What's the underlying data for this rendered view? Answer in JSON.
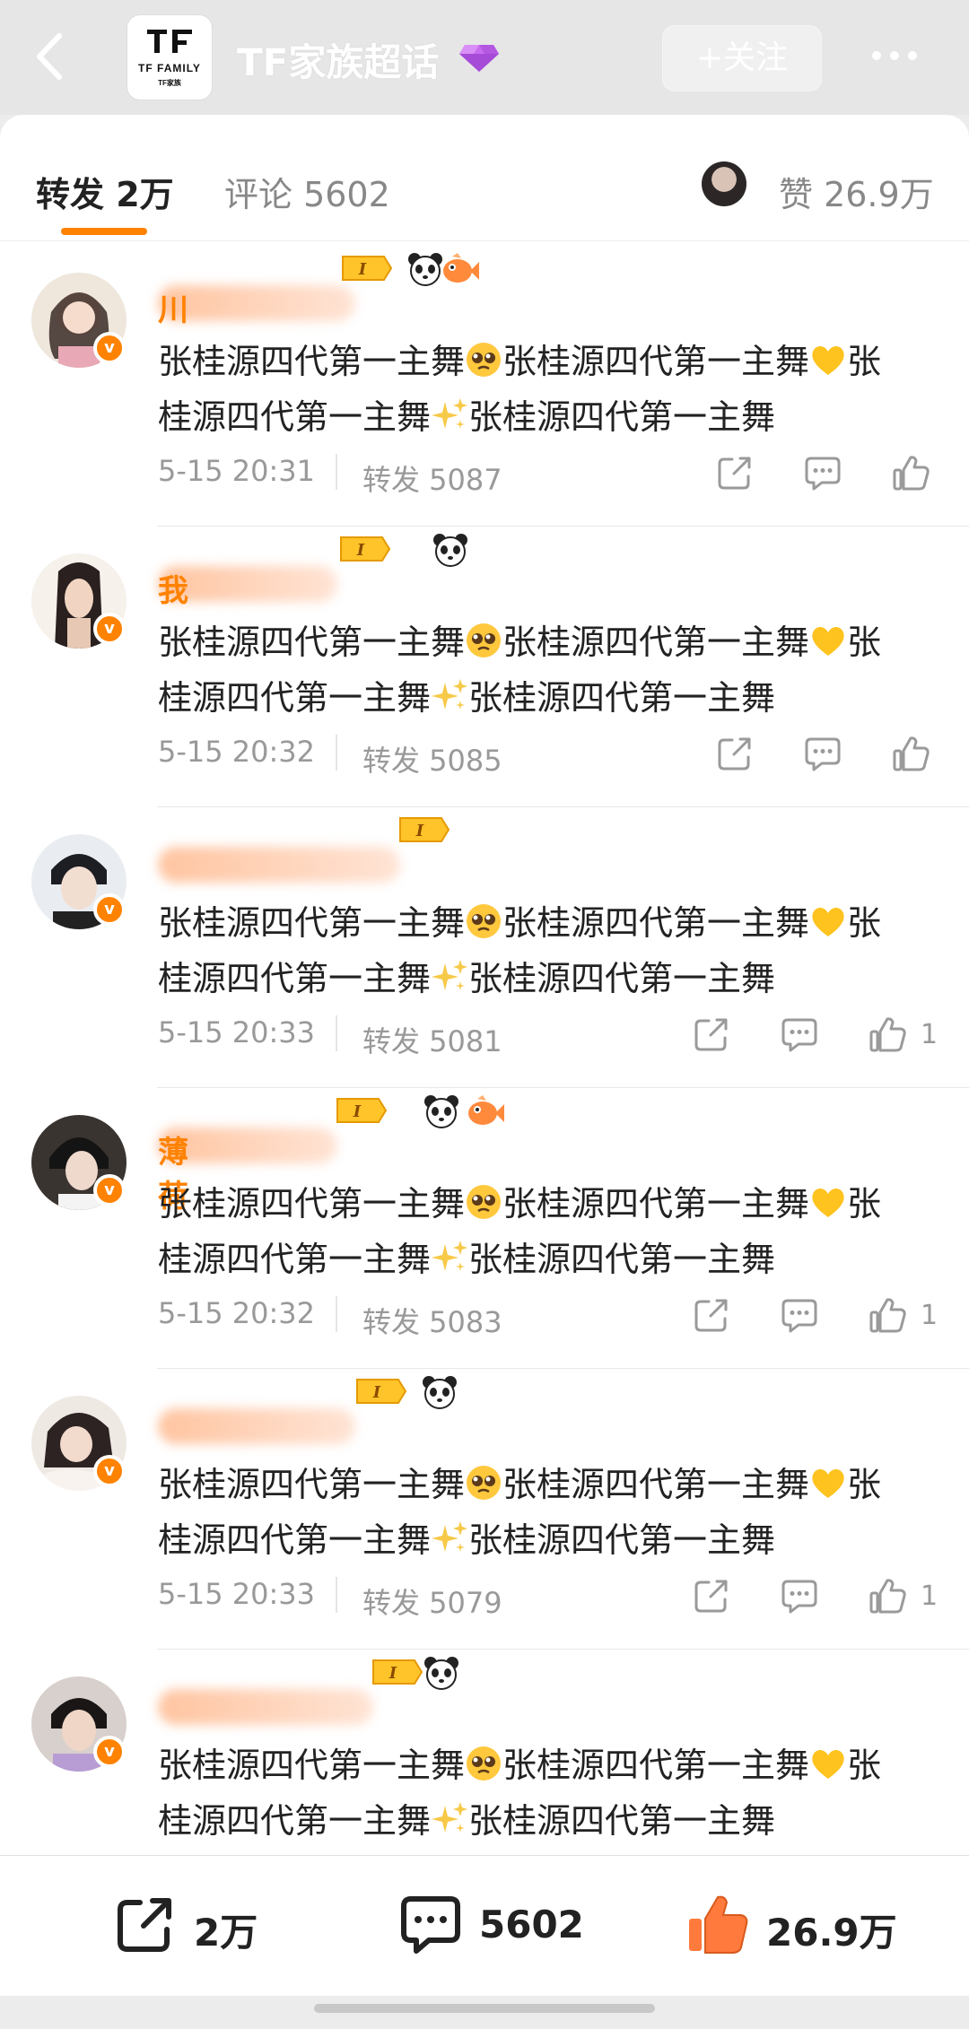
{
  "header": {
    "topic_title": "TF家族超话",
    "logo_text_line1": "TF FAMILY",
    "logo_text_line2": "TF家族",
    "follow_label": "+关注",
    "back_icon": "chevron-left-icon",
    "more_icon": "more-dots-icon"
  },
  "tabs": {
    "repost": "转发 2万",
    "comment": "评论 5602",
    "like": "赞 26.9万",
    "active": "repost",
    "accent": "#ff8200"
  },
  "segments": {
    "a": "张桂源四代第一主舞",
    "b": "张桂源四代第一主舞",
    "c": "张",
    "d": "桂源四代第一主舞",
    "e": "张桂源四代第一主舞"
  },
  "reposts": [
    {
      "name_first_char": "川",
      "time": "5-15 20:31",
      "repost": "转发 5087",
      "likes": ""
    },
    {
      "name_first_char": "我",
      "time": "5-15 20:32",
      "repost": "转发 5085",
      "likes": ""
    },
    {
      "name_first_char": "",
      "time": "5-15 20:33",
      "repost": "转发 5081",
      "likes": "1"
    },
    {
      "name_first_char": "薄荷",
      "time": "5-15 20:32",
      "repost": "转发 5083",
      "likes": "1"
    },
    {
      "name_first_char": "",
      "time": "5-15 20:33",
      "repost": "转发 5079",
      "likes": "1"
    },
    {
      "name_first_char": "",
      "time": "",
      "repost": "",
      "likes": ""
    }
  ],
  "bottom_bar": {
    "repost_count": "2万",
    "comment_count": "5602",
    "like_count": "26.9万"
  },
  "colors": {
    "accent": "#ff8200",
    "verified_badge": "#ff8200",
    "muted_text": "#999999"
  }
}
